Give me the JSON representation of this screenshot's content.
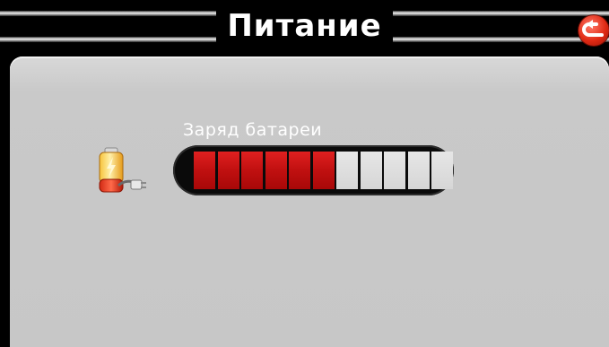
{
  "header": {
    "title": "Питание"
  },
  "battery": {
    "label": "Заряд батареи",
    "level_segments_filled": 6,
    "level_segments_total": 11,
    "fill_color": "#c81414",
    "empty_color": "#dcdcdc"
  },
  "icons": {
    "back": "back-arrow-icon",
    "battery": "battery-charging-icon"
  },
  "colors": {
    "background": "#000000",
    "panel": "#c8c8c8",
    "accent": "#e02a14"
  }
}
